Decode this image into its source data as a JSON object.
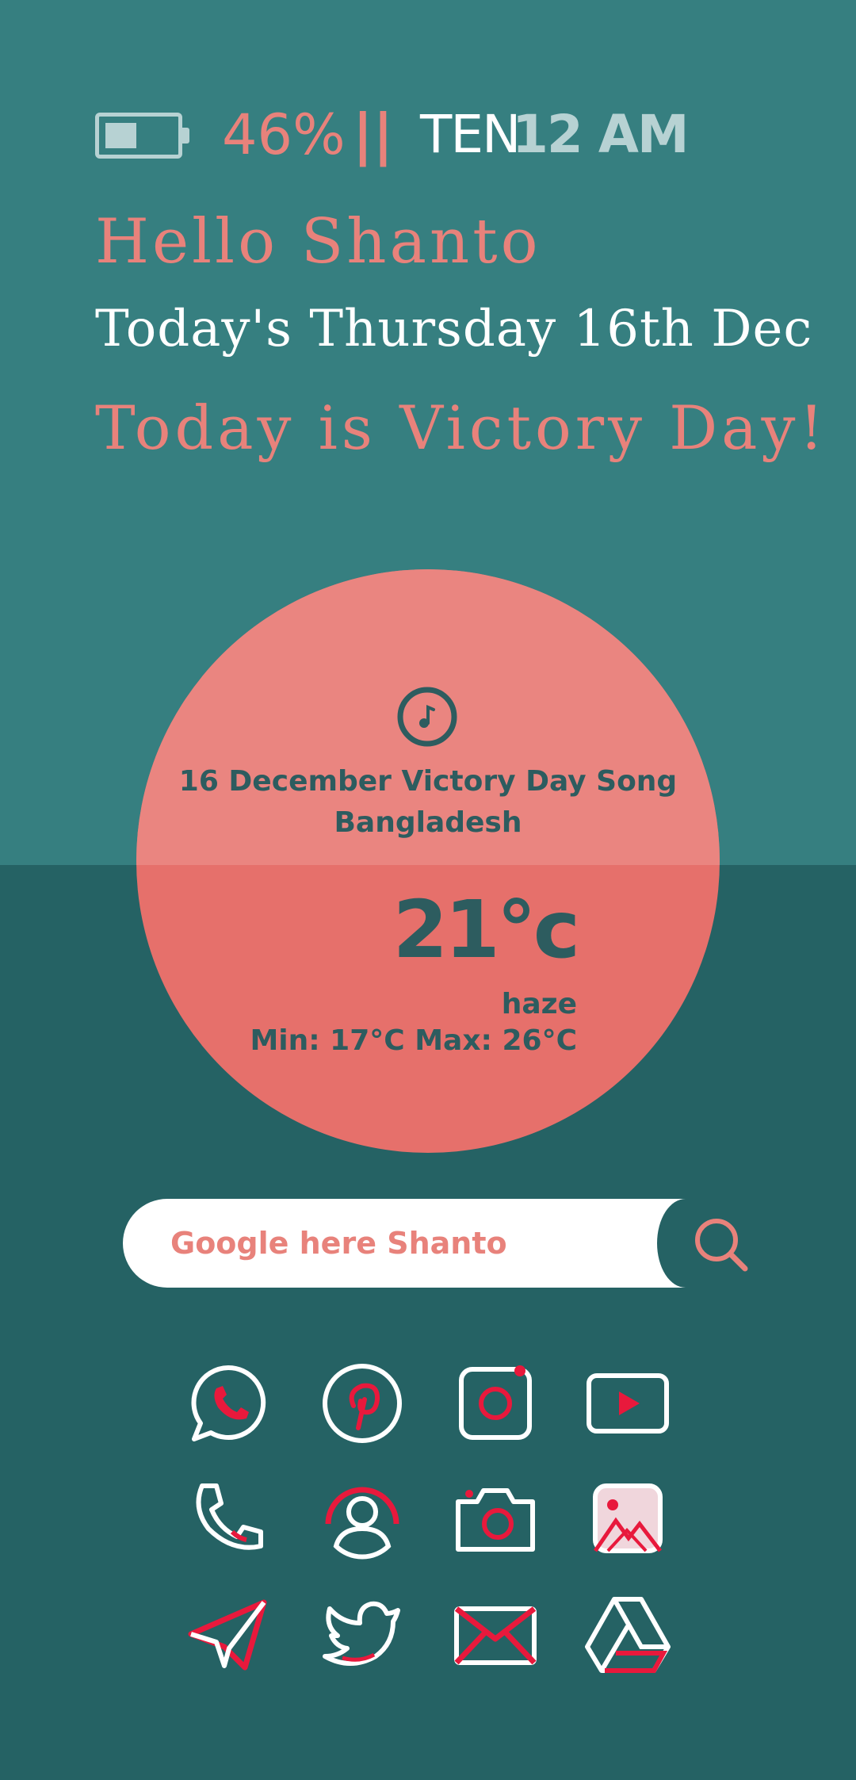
{
  "status": {
    "battery_percent": "46%",
    "battery_level": 0.46,
    "separator": "||",
    "hour_word": "TEN",
    "time": "12 AM"
  },
  "greeting": {
    "hello": "Hello Shanto",
    "today": "Today's Thursday 16th Dec",
    "special": "Today is Victory Day!"
  },
  "music": {
    "icon": "music-note-icon",
    "title": "16 December Victory Day Song Bangladesh"
  },
  "weather": {
    "temperature": "21°c",
    "condition": "haze",
    "min_max": "Min: 17°C  Max: 26°C"
  },
  "search": {
    "placeholder": "Google here Shanto",
    "icon": "search-icon"
  },
  "apps": [
    {
      "name": "whatsapp-icon"
    },
    {
      "name": "pinterest-icon"
    },
    {
      "name": "instagram-icon"
    },
    {
      "name": "youtube-icon"
    },
    {
      "name": "phone-icon"
    },
    {
      "name": "contacts-icon"
    },
    {
      "name": "camera-icon"
    },
    {
      "name": "gallery-icon"
    },
    {
      "name": "telegram-icon"
    },
    {
      "name": "twitter-icon"
    },
    {
      "name": "gmail-icon"
    },
    {
      "name": "drive-icon"
    }
  ],
  "colors": {
    "background_top": "#367f80",
    "background_bottom": "#256264",
    "accent": "#e8827b",
    "icon_red": "#e8193c",
    "text_dark": "#2d5c5f"
  }
}
